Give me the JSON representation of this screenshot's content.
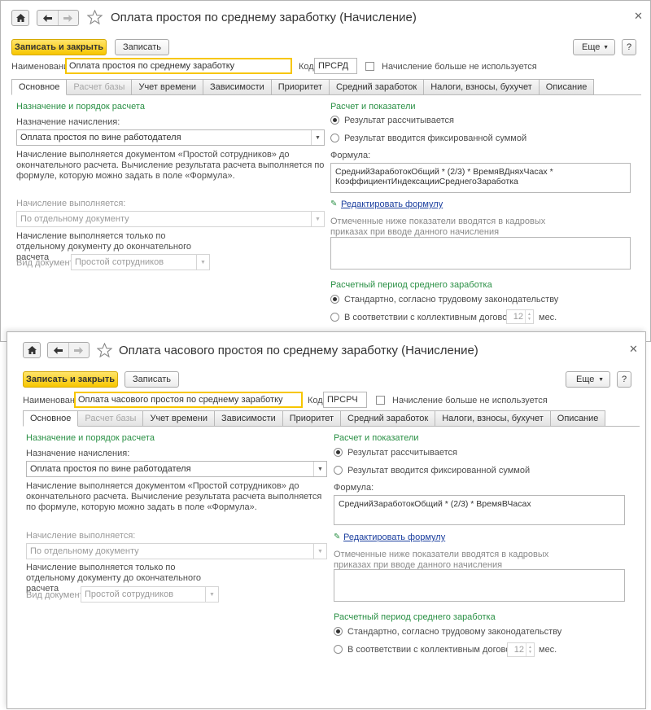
{
  "nav": {
    "home_icon": "home-icon",
    "back_icon": "arrow-left-icon",
    "forward_icon": "arrow-right-icon",
    "favorite_icon": "star-icon",
    "close_icon": "close-icon"
  },
  "colors": {
    "accent_yellow": "#f7c600",
    "section_green": "#2a9045",
    "link_blue": "#1a3e9e",
    "disabled_text": "#a8a8a8"
  },
  "window1": {
    "title": "Оплата простоя по среднему заработку (Начисление)",
    "buttons": {
      "save_close": "Записать и закрыть",
      "save": "Записать",
      "more": "Еще",
      "help": "?"
    },
    "name_label": "Наименование:",
    "name_value": "Оплата простоя по среднему заработку",
    "code_label": "Код:",
    "code_value": "ПРСРД",
    "unused_label": "Начисление больше не используется",
    "tabs": [
      "Основное",
      "Расчет базы",
      "Учет времени",
      "Зависимости",
      "Приоритет",
      "Средний заработок",
      "Налоги, взносы, бухучет",
      "Описание"
    ],
    "left": {
      "section_title": "Назначение и порядок расчета",
      "purpose_label": "Назначение начисления:",
      "purpose_value": "Оплата простоя по вине работодателя",
      "note1": "Начисление выполняется документом «Простой сотрудников» до окончательного расчета. Вычисление результата расчета выполняется по формуле, которую можно задать в поле «Формула».",
      "performed_label": "Начисление выполняется:",
      "performed_value": "По отдельному документу",
      "note2": "Начисление выполняется только по отдельному документу до окончательного расчета",
      "doc_type_label": "Вид документа:",
      "doc_type_value": "Простой сотрудников"
    },
    "right": {
      "section_title": "Расчет и показатели",
      "radio_calc": "Результат рассчитывается",
      "radio_fixed": "Результат вводится фиксированной суммой",
      "formula_label": "Формула:",
      "formula_value": "СреднийЗаработокОбщий * (2/3) * ВремяВДняхЧасах * КоэффициентИндексацииСреднегоЗаработка",
      "edit_formula": "Редактировать формулу",
      "indicators_note": "Отмеченные ниже показатели вводятся в кадровых приказах при вводе данного начисления",
      "period_title": "Расчетный период среднего заработка",
      "period_standard": "Стандартно, согласно трудовому законодательству",
      "period_agreement": "В соответствии с коллективным договором",
      "months_value": "12",
      "months_unit": "мес."
    }
  },
  "window2": {
    "title": "Оплата часового простоя по среднему заработку (Начисление)",
    "buttons": {
      "save_close": "Записать и закрыть",
      "save": "Записать",
      "more": "Еще",
      "help": "?"
    },
    "name_label": "Наименование:",
    "name_value": "Оплата часового простоя по среднему заработку",
    "code_label": "Код:",
    "code_value": "ПРСРЧ",
    "unused_label": "Начисление больше не используется",
    "tabs": [
      "Основное",
      "Расчет базы",
      "Учет времени",
      "Зависимости",
      "Приоритет",
      "Средний заработок",
      "Налоги, взносы, бухучет",
      "Описание"
    ],
    "left": {
      "section_title": "Назначение и порядок расчета",
      "purpose_label": "Назначение начисления:",
      "purpose_value": "Оплата простоя по вине работодателя",
      "note1": "Начисление выполняется документом «Простой сотрудников» до окончательного расчета. Вычисление результата расчета выполняется по формуле, которую можно задать в поле «Формула».",
      "performed_label": "Начисление выполняется:",
      "performed_value": "По отдельному документу",
      "note2": "Начисление выполняется только по отдельному документу до окончательного расчета",
      "doc_type_label": "Вид документа:",
      "doc_type_value": "Простой сотрудников"
    },
    "right": {
      "section_title": "Расчет и показатели",
      "radio_calc": "Результат рассчитывается",
      "radio_fixed": "Результат вводится фиксированной суммой",
      "formula_label": "Формула:",
      "formula_value": "СреднийЗаработокОбщий * (2/3) * ВремяВЧасах",
      "edit_formula": "Редактировать формулу",
      "indicators_note": "Отмеченные ниже показатели вводятся в кадровых приказах при вводе данного начисления",
      "period_title": "Расчетный период среднего заработка",
      "period_standard": "Стандартно, согласно трудовому законодательству",
      "period_agreement": "В соответствии с коллективным договором",
      "months_value": "12",
      "months_unit": "мес."
    }
  }
}
